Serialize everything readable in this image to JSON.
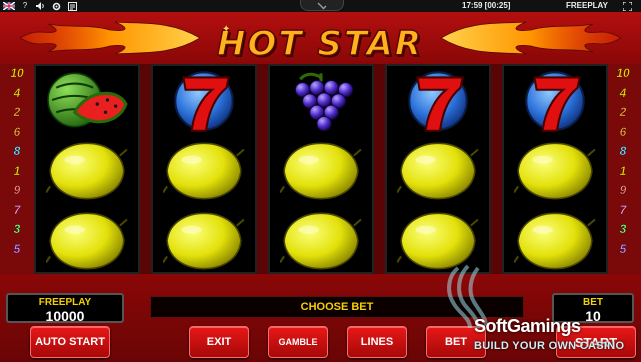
{
  "topbar": {
    "flag_icon": "uk-flag-icon",
    "help_label": "?",
    "clock": "17:59 [00:25]",
    "mode": "FREEPLAY"
  },
  "game": {
    "title": "HOT STAR"
  },
  "paylines_left": [
    "10",
    "4",
    "2",
    "6",
    "8",
    "1",
    "9",
    "7",
    "3",
    "5"
  ],
  "paylines_right": [
    "10",
    "4",
    "2",
    "6",
    "8",
    "1",
    "9",
    "7",
    "3",
    "5"
  ],
  "payline_colors": [
    "#f5d000",
    "#f5d000",
    "#ff9d2e",
    "#ff9d2e",
    "#7ad6ff",
    "#f5d000",
    "#ff7a7a",
    "#ff8ad8",
    "#7aff7a",
    "#c68aff"
  ],
  "reels": [
    [
      "watermelon",
      "lemon",
      "lemon"
    ],
    [
      "seven",
      "lemon",
      "lemon"
    ],
    [
      "grapes",
      "lemon",
      "lemon"
    ],
    [
      "seven",
      "lemon",
      "lemon"
    ],
    [
      "seven",
      "lemon",
      "lemon"
    ]
  ],
  "balance": {
    "label": "FREEPLAY",
    "value": "10000"
  },
  "bet": {
    "label": "BET",
    "value": "10"
  },
  "message": "CHOOSE BET",
  "buttons": {
    "autostart": "AUTO START",
    "exit": "EXIT",
    "gamble": "GAMBLE",
    "lines": "LINES",
    "bet": "BET",
    "start": "START"
  },
  "watermark": {
    "title": "SoftGamings",
    "subtitle": "BUILD YOUR OWN CASINO"
  }
}
